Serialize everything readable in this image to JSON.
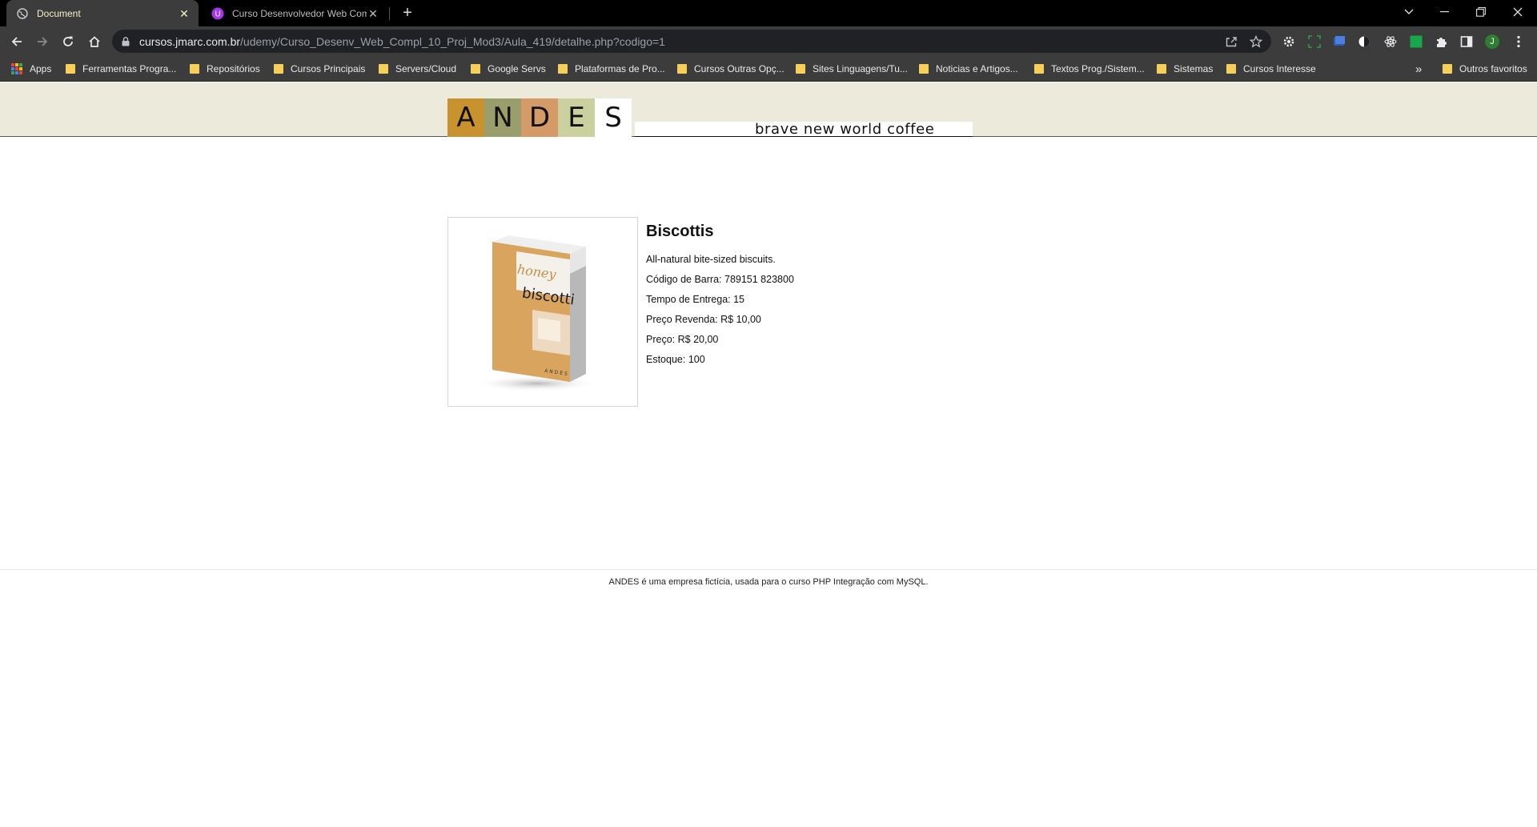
{
  "tabs": [
    {
      "title": "Document",
      "active": true
    },
    {
      "title": "Curso Desenvolvedor Web Comp",
      "active": false
    }
  ],
  "address_bar": {
    "host": "cursos.jmarc.com.br",
    "path": "/udemy/Curso_Desenv_Web_Compl_10_Proj_Mod3/Aula_419/detalhe.php?codigo=1"
  },
  "profile_initial": "J",
  "bookmarks": {
    "items": [
      {
        "label": "Apps"
      },
      {
        "label": "Ferramentas Progra..."
      },
      {
        "label": "Repositórios"
      },
      {
        "label": "Cursos Principais"
      },
      {
        "label": "Servers/Cloud"
      },
      {
        "label": "Google Servs"
      },
      {
        "label": "Plataformas de Pro..."
      },
      {
        "label": "Cursos Outras Opç..."
      },
      {
        "label": "Sites Linguagens/Tu..."
      },
      {
        "label": "Noticias e Artigos..."
      },
      {
        "label": "Textos Prog./Sistem..."
      },
      {
        "label": "Sistemas"
      },
      {
        "label": "Cursos Interesse"
      }
    ],
    "overflow": "»",
    "other": "Outros favoritos"
  },
  "site": {
    "logo_letters": [
      "A",
      "N",
      "D",
      "E",
      "S"
    ],
    "logo_colors": [
      "#c8932e",
      "#9a9e6c",
      "#d49a68",
      "#cbd19e",
      "#ffffff"
    ],
    "tagline": "brave new world coffee"
  },
  "product": {
    "name": "Biscottis",
    "description": "All-natural bite-sized biscuits.",
    "barcode_label": "Código de Barra:",
    "barcode": "789151 823800",
    "delivery_label": "Tempo de Entrega:",
    "delivery": "15",
    "resale_label": "Preço Revenda:",
    "resale_price": "R$ 10,00",
    "price_label": "Preço:",
    "price": "R$ 20,00",
    "stock_label": "Estoque:",
    "stock": "100",
    "image_text": {
      "top": "honey",
      "main": "biscotti",
      "brand": "ANDES"
    }
  },
  "footer": {
    "text": "ANDES é uma empresa fictícia, usada para o curso PHP Integração com MySQL."
  }
}
